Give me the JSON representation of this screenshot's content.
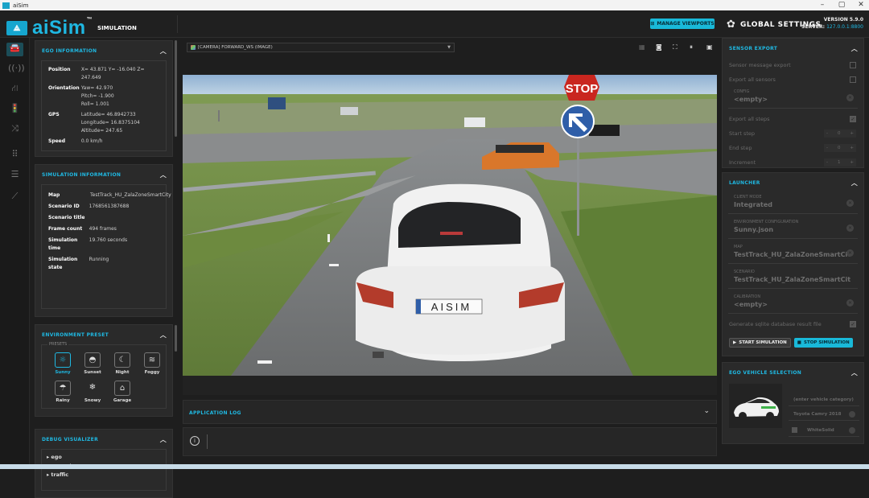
{
  "window": {
    "title": "aiSim",
    "controls": [
      "–",
      "▢",
      "✕"
    ]
  },
  "header": {
    "brand": "aiSim",
    "trademark": "™",
    "subtitle": "SIMULATION",
    "manage_viewports": "MANAGE VIEWPORTS",
    "settings_title": "GLOBAL SETTINGS",
    "version": "VERSION 5.9.0",
    "server_label": "SERVER:",
    "server_value": "127.0.0.1:8800"
  },
  "accent": "#1fb8e2",
  "rail_icons": [
    "car-icon",
    "sensor-icon",
    "road-icon",
    "traffic-icon",
    "scenario-icon",
    "grid-icon",
    "layers-icon",
    "chart-icon"
  ],
  "ego": {
    "title": "EGO INFORMATION",
    "position_label": "Position",
    "position": "X= 43.871 Y= -16.040 Z= 247.649",
    "orientation_label": "Orientation",
    "yaw": "Yaw= 42.970",
    "pitch": "Pitch= -1.900",
    "roll": "Roll= 1.001",
    "gps_label": "GPS",
    "latitude": "Latitude= 46.8942733",
    "longitude": "Longitude= 16.8375104",
    "altitude": "Altitude= 247.65",
    "speed_label": "Speed",
    "speed": "0.0 km/h"
  },
  "siminfo": {
    "title": "SIMULATION INFORMATION",
    "map_label": "Map",
    "map": "TestTrack_HU_ZalaZoneSmartCity",
    "scenario_id_label": "Scenario ID",
    "scenario_id": "1768561387688",
    "scenario_title_label": "Scenario title",
    "scenario_title": "",
    "frame_count_label": "Frame count",
    "frame_count": "494 frames",
    "sim_time_label": "Simulation time",
    "sim_time": "19.760 seconds",
    "sim_state_label": "Simulation state",
    "sim_state": "Running"
  },
  "environment": {
    "title": "ENVIRONMENT PRESET",
    "group": "PRESETS",
    "presets": [
      "Sunny",
      "Sunset",
      "Night",
      "Foggy",
      "Rainy",
      "Snowy",
      "Garage"
    ],
    "selected": "Sunny"
  },
  "debug": {
    "title": "DEBUG VISUALIZER",
    "items": [
      "ego",
      "scenario",
      "traffic"
    ]
  },
  "viewport": {
    "camera": "[CAMERA]  FORWARD_WS (IMAGE)",
    "stop_sign": "STOP",
    "plate": "AISIM"
  },
  "applog": {
    "title": "APPLICATION LOG"
  },
  "sensor_export": {
    "title": "SENSOR EXPORT",
    "message_export": "Sensor message export",
    "export_all_sensors": "Export all sensors",
    "config_label": "CONFIG",
    "config_value": "<empty>",
    "export_all_steps": "Export all steps",
    "start_step": "Start step",
    "start_val": "0",
    "end_step": "End step",
    "end_val": "0",
    "increment": "Increment",
    "inc_val": "1"
  },
  "launcher": {
    "title": "LAUNCHER",
    "client_mode_label": "CLIENT MODE",
    "client_mode": "Integrated",
    "env_config_label": "ENVIRONMENT CONFIGURATION",
    "env_config": "Sunny.json",
    "map_label": "MAP",
    "map": "TestTrack_HU_ZalaZoneSmartCity",
    "scenario_label": "SCENARIO",
    "scenario": "TestTrack_HU_ZalaZoneSmartCity_d...",
    "calibration_label": "CALIBRATION",
    "calibration": "<empty>",
    "sqlite": "Generate sqlite database result file",
    "start": "START SIMULATION",
    "stop": "STOP SIMULATION"
  },
  "vehicle": {
    "title": "EGO VEHICLE SELECTION",
    "category": "(enter vehicle category)",
    "model": "Toyota Camry 2018",
    "color": "WhiteSolid"
  }
}
